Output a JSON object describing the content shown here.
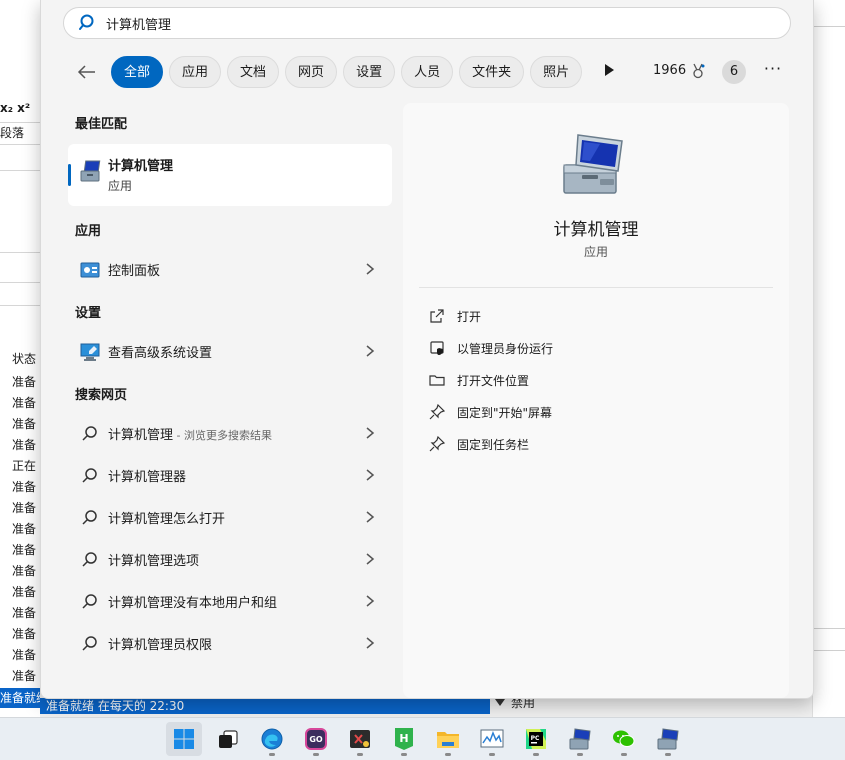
{
  "search": {
    "query": "计算机管理"
  },
  "filters": {
    "tabs": [
      "全部",
      "应用",
      "文档",
      "网页",
      "设置",
      "人员",
      "文件夹",
      "照片"
    ],
    "points": "1966",
    "badge": "6"
  },
  "left": {
    "best_match_title": "最佳匹配",
    "best": {
      "name": "计算机管理",
      "type": "应用"
    },
    "apps_title": "应用",
    "apps": [
      {
        "label": "控制面板"
      }
    ],
    "settings_title": "设置",
    "settings": [
      {
        "label": "查看高级系统设置"
      }
    ],
    "web_title": "搜索网页",
    "web": [
      {
        "label": "计算机管理",
        "hint": " - 浏览更多搜索结果"
      },
      {
        "label": "计算机管理器",
        "hint": ""
      },
      {
        "label": "计算机管理怎么打开",
        "hint": ""
      },
      {
        "label": "计算机管理选项",
        "hint": ""
      },
      {
        "label": "计算机管理没有本地用户和组",
        "hint": ""
      },
      {
        "label": "计算机管理员权限",
        "hint": ""
      }
    ]
  },
  "detail": {
    "title": "计算机管理",
    "type": "应用",
    "actions": [
      "打开",
      "以管理员身份运行",
      "打开文件位置",
      "固定到\"开始\"屏幕",
      "固定到任务栏"
    ]
  },
  "background": {
    "left_rows": [
      "x₂  x²",
      "段落",
      "状态",
      "准备",
      "准备",
      "准备",
      "准备",
      "正在",
      "准备",
      "准备",
      "准备",
      "准备",
      "准备",
      "准备",
      "准备",
      "准备",
      "准备",
      "准备"
    ],
    "selected_row": "准备就绪",
    "bottom_bar": "准备就绪   在每天的 22:30",
    "bottom_disabled": "禁用"
  },
  "taskbar": {
    "apps": [
      "start-icon",
      "task-view-icon",
      "edge-icon",
      "go-app-icon",
      "media-app-icon",
      "html-builder-icon",
      "file-explorer-icon",
      "performance-monitor-icon",
      "pycharm-icon",
      "computer-management-icon",
      "wechat-icon",
      "computer-management-icon"
    ]
  }
}
